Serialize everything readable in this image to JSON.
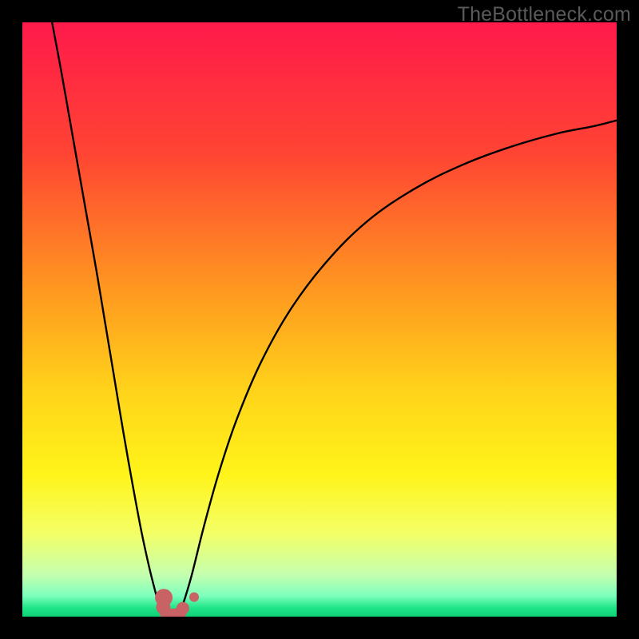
{
  "watermark": "TheBottleneck.com",
  "chart_data": {
    "type": "line",
    "title": "",
    "xlabel": "",
    "ylabel": "",
    "xlim": [
      0,
      100
    ],
    "ylim": [
      0,
      100
    ],
    "grid": false,
    "legend": false,
    "gradient_stops": [
      {
        "pct": 0.0,
        "color": "#ff1a4b"
      },
      {
        "pct": 0.22,
        "color": "#ff4433"
      },
      {
        "pct": 0.45,
        "color": "#ff9820"
      },
      {
        "pct": 0.62,
        "color": "#ffd31a"
      },
      {
        "pct": 0.76,
        "color": "#fff41a"
      },
      {
        "pct": 0.86,
        "color": "#f4ff66"
      },
      {
        "pct": 0.93,
        "color": "#c4ffb0"
      },
      {
        "pct": 0.965,
        "color": "#7dffbd"
      },
      {
        "pct": 0.985,
        "color": "#20e688"
      },
      {
        "pct": 1.0,
        "color": "#0fd276"
      }
    ],
    "series": [
      {
        "name": "left-curve",
        "x": [
          5.0,
          6.5,
          8.0,
          9.5,
          11.0,
          12.5,
          14.0,
          15.5,
          17.0,
          18.5,
          20.0,
          21.3,
          22.3,
          23.0,
          23.5,
          23.8
        ],
        "values": [
          100.0,
          92.0,
          83.5,
          75.0,
          66.5,
          58.0,
          49.0,
          40.0,
          31.0,
          22.5,
          14.5,
          8.5,
          4.5,
          2.0,
          0.8,
          0.0
        ]
      },
      {
        "name": "right-curve",
        "x": [
          26.2,
          27.0,
          28.5,
          30.5,
          33.0,
          36.0,
          40.0,
          45.0,
          51.0,
          58.0,
          66.0,
          74.0,
          82.0,
          90.0,
          96.0,
          100.0
        ],
        "values": [
          0.0,
          2.0,
          7.0,
          15.0,
          24.0,
          33.0,
          42.5,
          51.5,
          59.5,
          66.5,
          72.0,
          76.0,
          79.0,
          81.3,
          82.5,
          83.5
        ]
      }
    ],
    "markers": [
      {
        "x": 23.8,
        "y": 3.2,
        "r": 11,
        "color": "#c86264"
      },
      {
        "x": 23.7,
        "y": 1.6,
        "r": 9,
        "color": "#c86264"
      },
      {
        "x": 24.2,
        "y": 0.6,
        "r": 8,
        "color": "#c86264"
      },
      {
        "x": 25.4,
        "y": 0.3,
        "r": 8,
        "color": "#c86264"
      },
      {
        "x": 26.5,
        "y": 0.6,
        "r": 8,
        "color": "#c86264"
      },
      {
        "x": 27.0,
        "y": 1.4,
        "r": 8,
        "color": "#c86264"
      },
      {
        "x": 28.9,
        "y": 3.3,
        "r": 6,
        "color": "#c86264"
      }
    ]
  }
}
